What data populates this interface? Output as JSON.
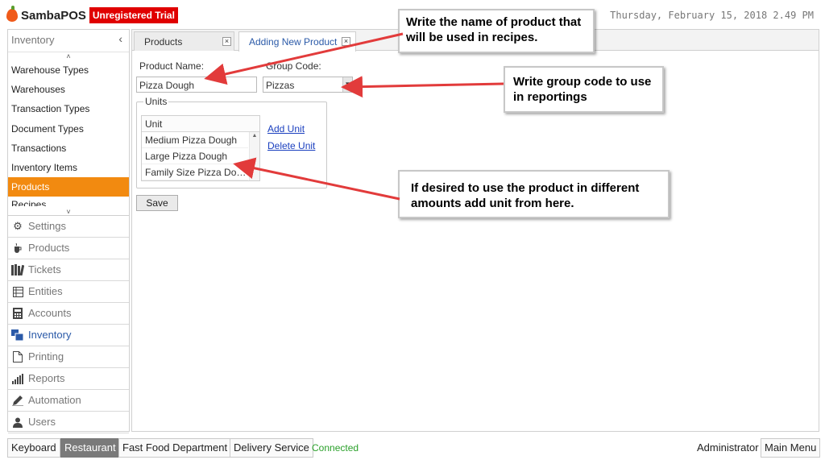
{
  "header": {
    "app_name": "SambaPOS",
    "trial_badge": "Unregistered Trial",
    "datetime": "Thursday, February 15, 2018 2.49 PM"
  },
  "sidebar": {
    "title": "Inventory",
    "collapse_glyph": "‹",
    "sub_items": [
      {
        "label": "Warehouse Types"
      },
      {
        "label": "Warehouses"
      },
      {
        "label": "Transaction Types"
      },
      {
        "label": "Document Types"
      },
      {
        "label": "Transactions"
      },
      {
        "label": "Inventory Items"
      },
      {
        "label": "Products",
        "active": true
      },
      {
        "label": "Recipes"
      }
    ],
    "nav_items": [
      {
        "label": "Settings",
        "icon": "gear-icon"
      },
      {
        "label": "Products",
        "icon": "cup-icon"
      },
      {
        "label": "Tickets",
        "icon": "books-icon"
      },
      {
        "label": "Entities",
        "icon": "table-icon"
      },
      {
        "label": "Accounts",
        "icon": "calculator-icon"
      },
      {
        "label": "Inventory",
        "icon": "inventory-icon",
        "current": true
      },
      {
        "label": "Printing",
        "icon": "document-icon"
      },
      {
        "label": "Reports",
        "icon": "bar-chart-icon"
      },
      {
        "label": "Automation",
        "icon": "pen-icon"
      },
      {
        "label": "Users",
        "icon": "user-icon"
      }
    ]
  },
  "tabs": [
    {
      "label": "Products",
      "active": false
    },
    {
      "label": "Adding New Product",
      "active": true
    }
  ],
  "form": {
    "product_name_label": "Product Name:",
    "product_name_value": "Pizza Dough",
    "group_code_label": "Group Code:",
    "group_code_value": "Pizzas",
    "units_legend": "Units",
    "units_header": "Unit",
    "units": [
      "Medium Pizza Dough",
      "Large Pizza Dough",
      "Family Size Pizza Dough"
    ],
    "add_unit": "Add Unit",
    "delete_unit": "Delete Unit",
    "save": "Save"
  },
  "annotations": [
    {
      "text": "Write the name of product that will be used in recipes."
    },
    {
      "text": "Write group code to use in reportings"
    },
    {
      "text": "If desired to use the product in different amounts add unit from here."
    }
  ],
  "bottom_bar": {
    "buttons": [
      "Keyboard",
      "Restaurant",
      "Fast Food Department",
      "Delivery Service"
    ],
    "active_button": "Restaurant",
    "status": "Connected",
    "user": "Administrator",
    "main_menu": "Main Menu"
  },
  "colors": {
    "accent_orange": "#f28a10",
    "trial_red": "#e00000",
    "arrow_red": "#e23b3b",
    "link_blue": "#1a3fbf",
    "connected_green": "#2aa02a"
  }
}
